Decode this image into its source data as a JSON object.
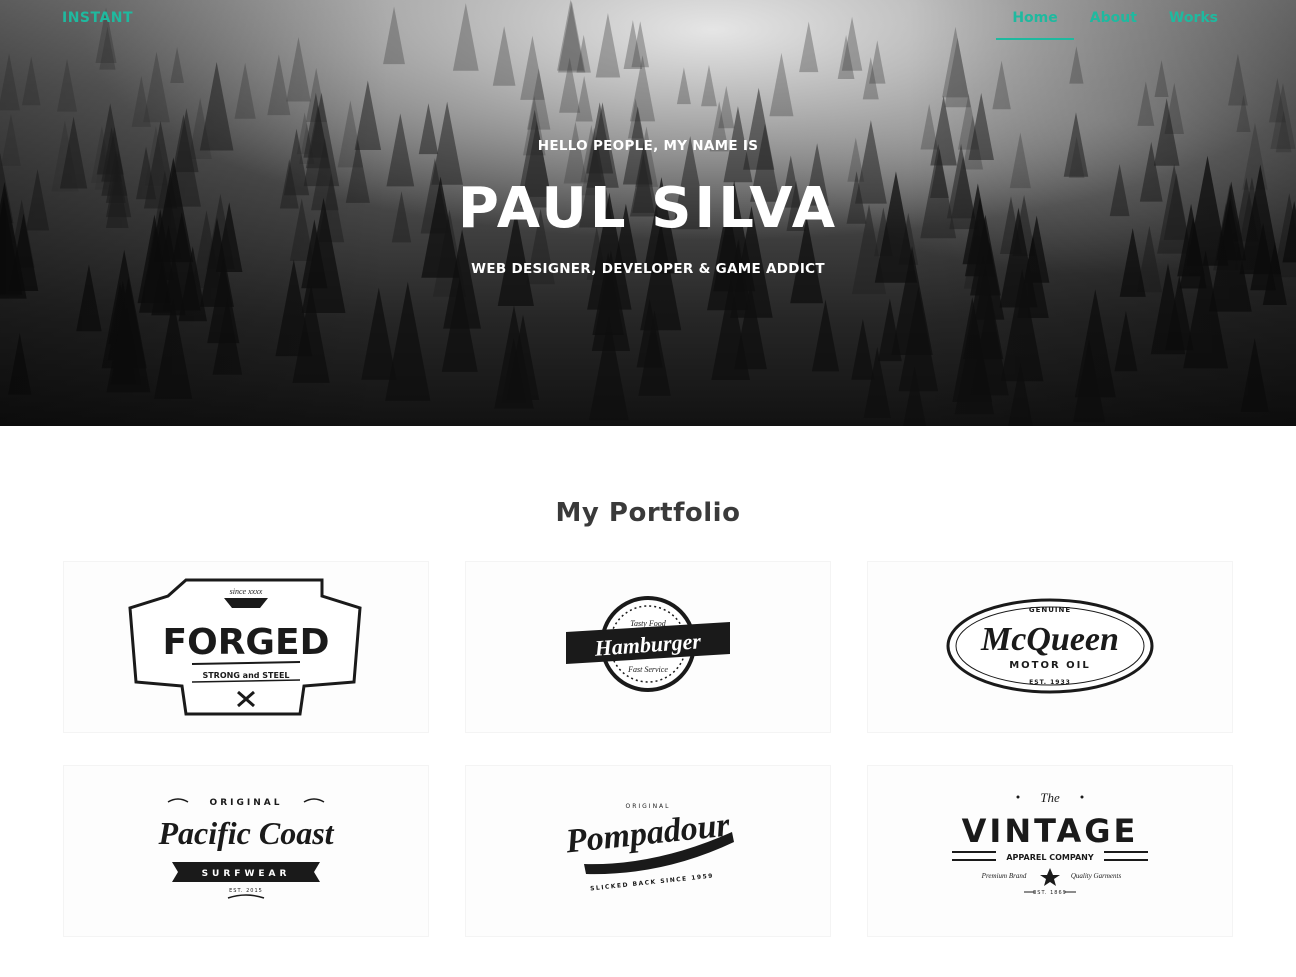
{
  "header": {
    "brand": "INSTANT",
    "nav": [
      {
        "label": "Home",
        "active": true
      },
      {
        "label": "About",
        "active": false
      },
      {
        "label": "Works",
        "active": false
      }
    ]
  },
  "hero": {
    "greeting": "HELLO PEOPLE, MY NAME IS",
    "name": "PAUL SILVA",
    "tagline": "WEB DESIGNER, DEVELOPER & GAME ADDICT"
  },
  "portfolio": {
    "title": "My Portfolio",
    "items": [
      {
        "logo": "forged-logo",
        "main": "FORGED",
        "top": "since xxxx",
        "sub": "STRONG and STEEL"
      },
      {
        "logo": "hamburger-logo",
        "main": "Hamburger",
        "top": "Tasty Food",
        "sub": "Fast Service"
      },
      {
        "logo": "mcqueen-logo",
        "main": "McQueen",
        "top": "GENUINE",
        "sub": "MOTOR OIL",
        "foot": "EST. 1933"
      },
      {
        "logo": "pacific-coast-logo",
        "main": "Pacific Coast",
        "top": "ORIGINAL",
        "sub": "SURFWEAR",
        "foot": "EST. 2015"
      },
      {
        "logo": "pompadour-logo",
        "main": "Pompadour",
        "top": "ORIGINAL",
        "sub": "SLICKED BACK SINCE 1959"
      },
      {
        "logo": "vintage-logo",
        "main": "VINTAGE",
        "top": "The",
        "sub": "APPAREL COMPANY",
        "left": "Premium Brand",
        "right": "Quality Garments",
        "foot": "EST. 1869"
      }
    ]
  },
  "colors": {
    "accent": "#1fb99f",
    "hero_text": "#ffffff",
    "title_text": "#3a3a3a",
    "logo_ink": "#1a1a1a"
  }
}
